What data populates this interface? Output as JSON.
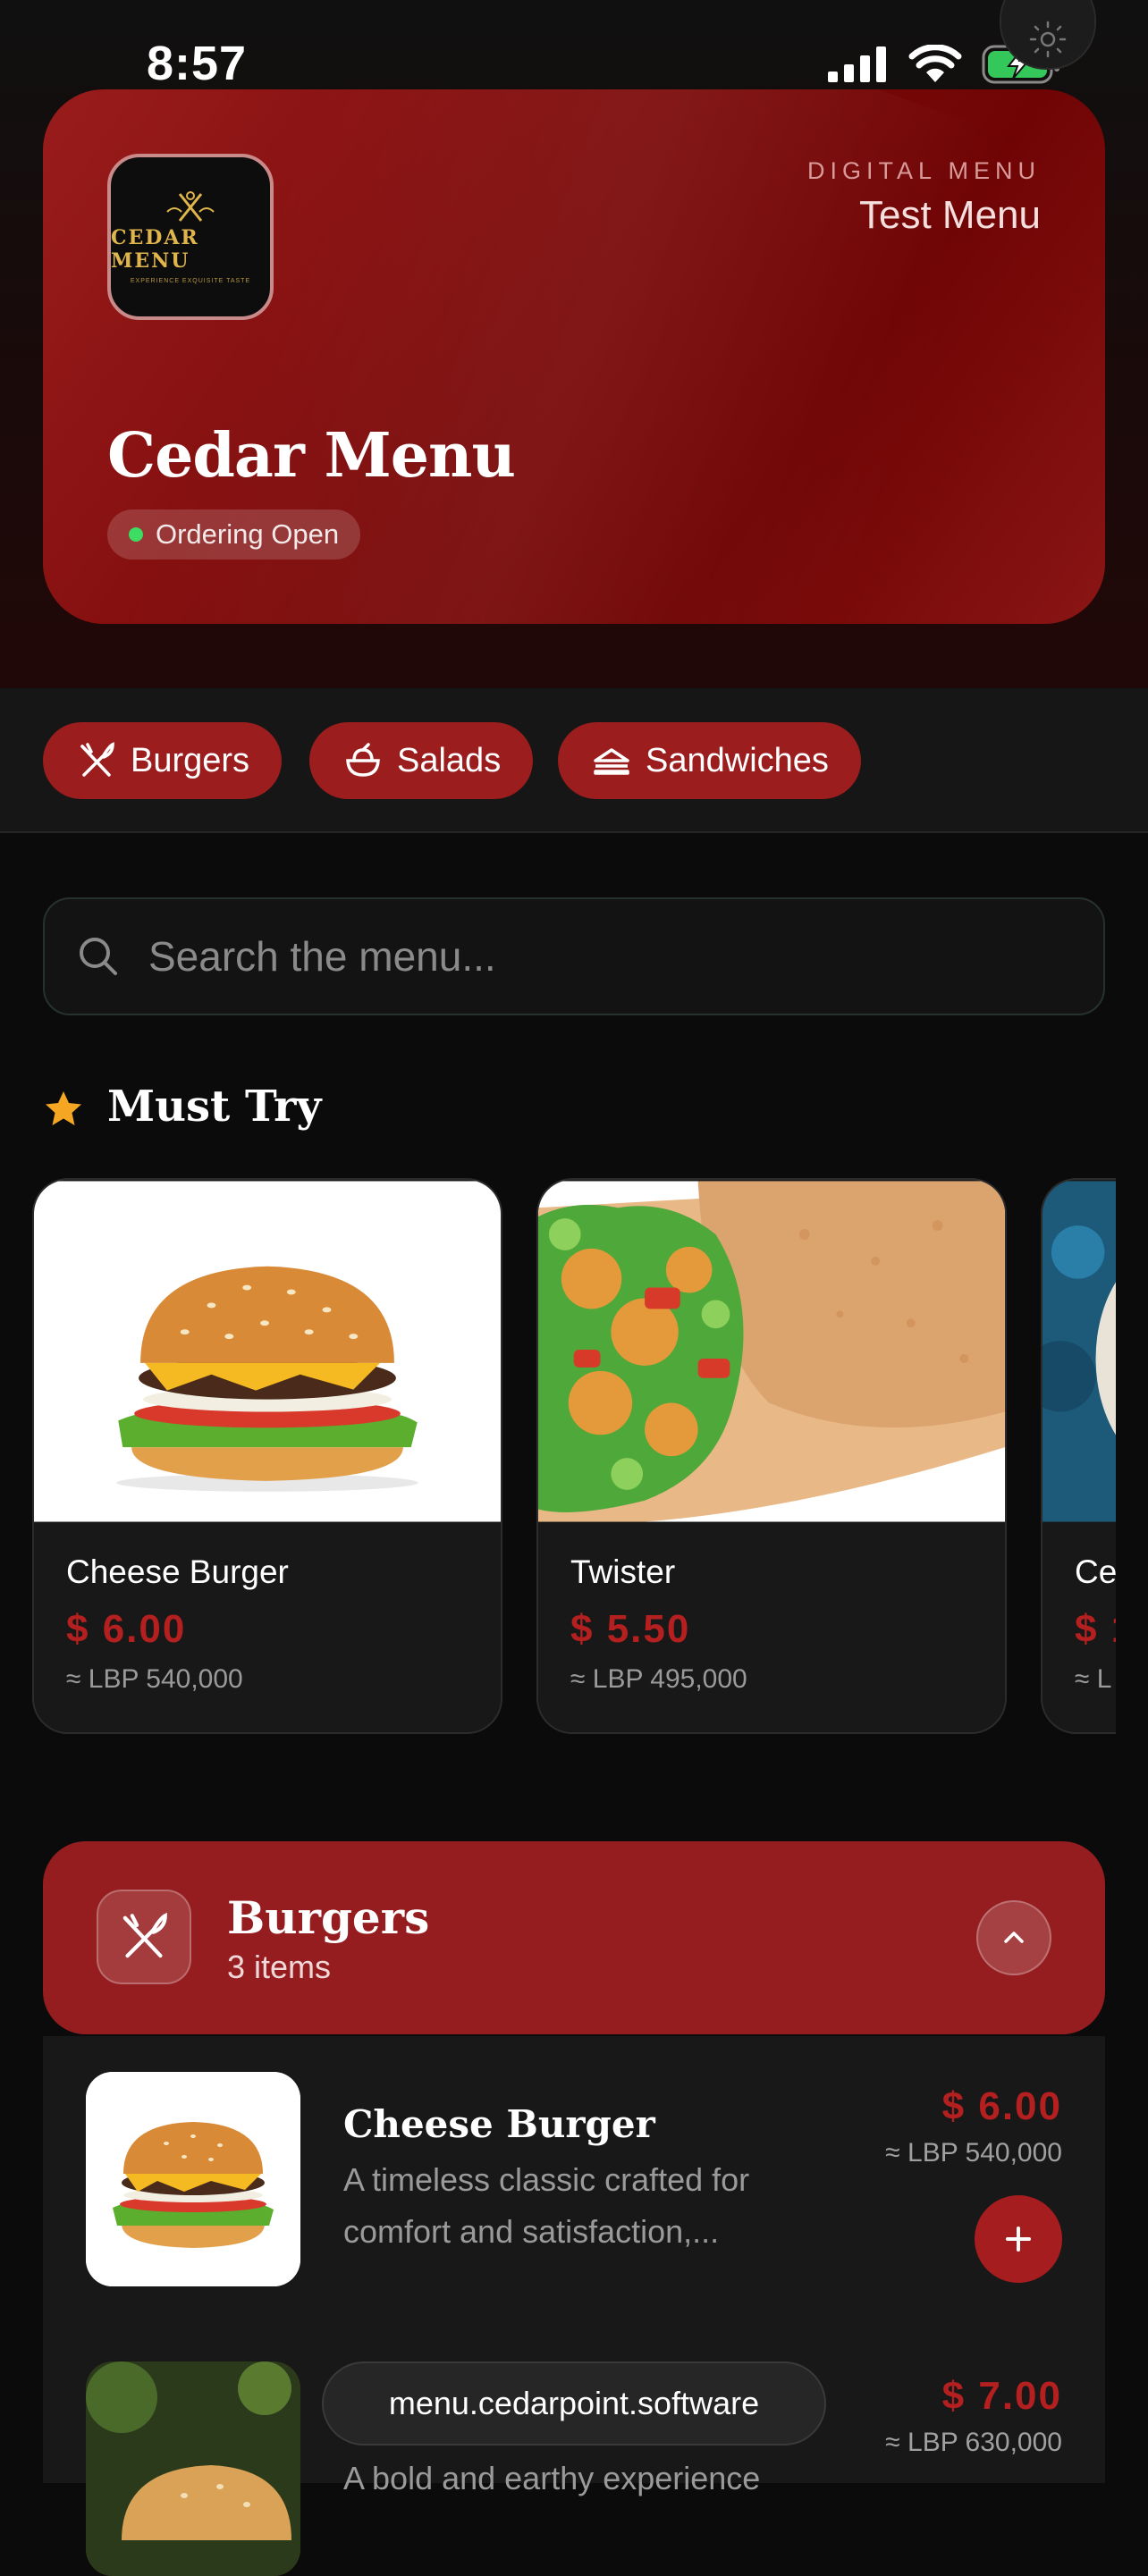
{
  "status_bar": {
    "time": "8:57"
  },
  "header": {
    "logo_text": "CEDAR MENU",
    "logo_tagline": "EXPERIENCE EXQUISITE TASTE",
    "eyebrow": "DIGITAL MENU",
    "menu_name": "Test Menu",
    "restaurant_name": "Cedar Menu",
    "ordering_status": "Ordering Open"
  },
  "categories": [
    {
      "label": "Burgers",
      "icon": "utensils-crossed-icon"
    },
    {
      "label": "Salads",
      "icon": "salad-bowl-icon"
    },
    {
      "label": "Sandwiches",
      "icon": "sandwich-icon"
    }
  ],
  "search": {
    "placeholder": "Search the menu..."
  },
  "must_try": {
    "title": "Must Try",
    "items": [
      {
        "name": "Cheese Burger",
        "price": "$ 6.00",
        "lbp": "≈ LBP 540,000"
      },
      {
        "name": "Twister",
        "price": "$ 5.50",
        "lbp": "≈ LBP 495,000"
      },
      {
        "name": "Ce",
        "price": "$ 1",
        "lbp": "≈ L"
      }
    ]
  },
  "section": {
    "name": "Burgers",
    "count": "3 items",
    "items": [
      {
        "name": "Cheese Burger",
        "description_line1": "A timeless classic crafted for",
        "description_line2": "comfort and satisfaction,...",
        "price": "$ 6.00",
        "lbp": "≈ LBP 540,000"
      },
      {
        "name": "",
        "description_line1": "A bold and earthy experience",
        "price": "$ 7.00",
        "lbp": "≈ LBP 630,000"
      }
    ]
  },
  "browser": {
    "url": "menu.cedarpoint.software"
  },
  "colors": {
    "accent": "#9b1d1d",
    "price": "#b41f1f",
    "status_dot": "#3ddc62",
    "star": "#f5a623"
  }
}
